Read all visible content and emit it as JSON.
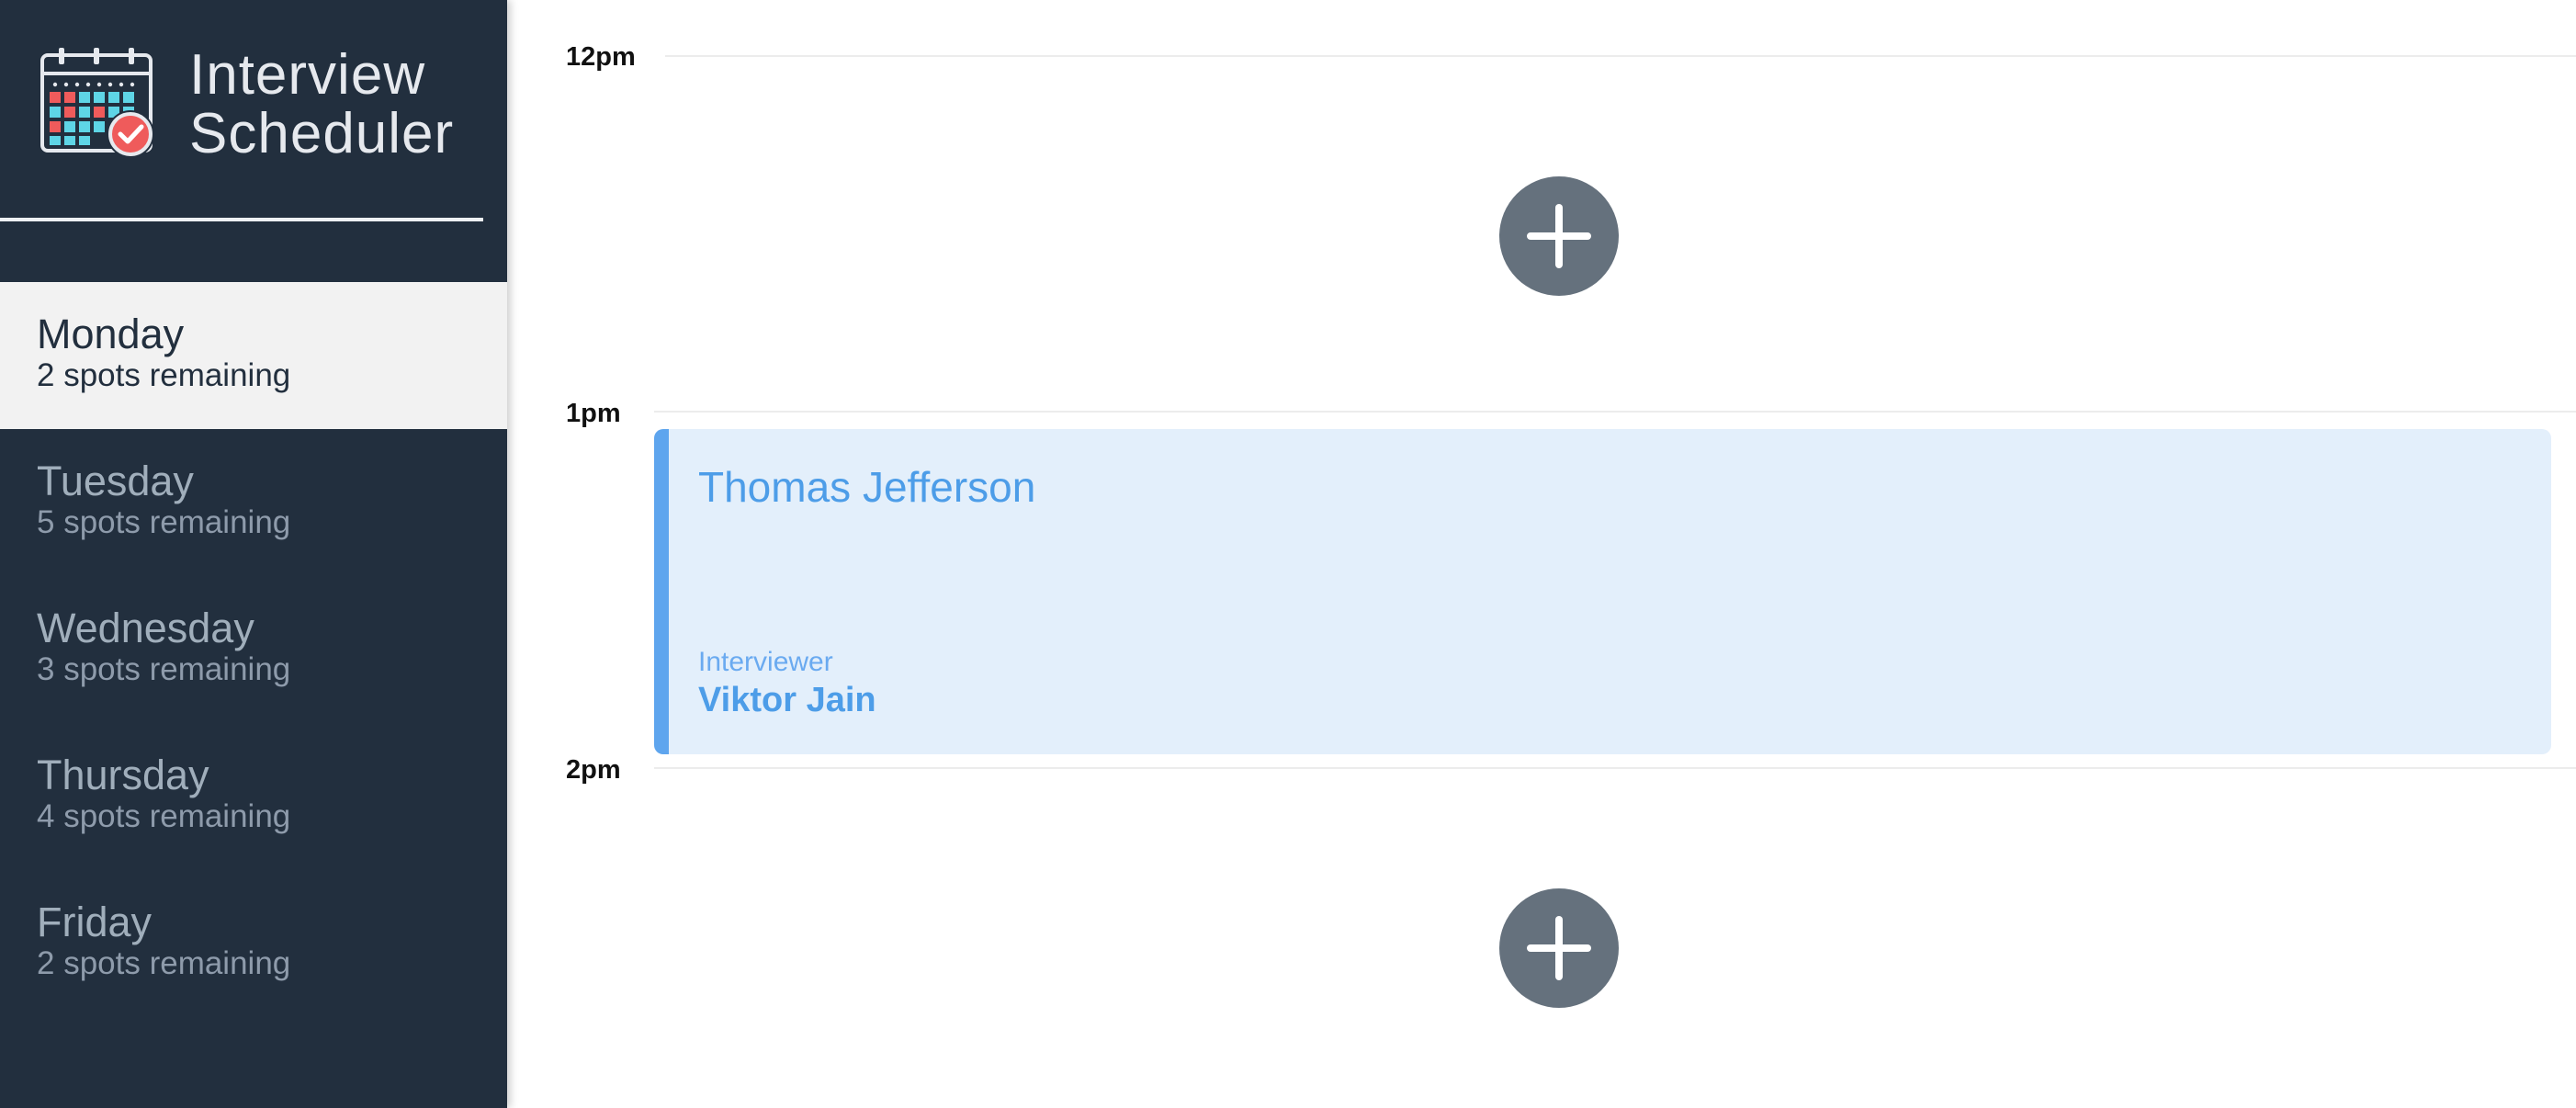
{
  "app": {
    "title_line1": "Interview",
    "title_line2": "Scheduler",
    "logo_icon": "calendar-check-icon"
  },
  "sidebar": {
    "days": [
      {
        "name": "Monday",
        "spots": "2 spots remaining",
        "selected": true
      },
      {
        "name": "Tuesday",
        "spots": "5 spots remaining",
        "selected": false
      },
      {
        "name": "Wednesday",
        "spots": "3 spots remaining",
        "selected": false
      },
      {
        "name": "Thursday",
        "spots": "4 spots remaining",
        "selected": false
      },
      {
        "name": "Friday",
        "spots": "2 spots remaining",
        "selected": false
      }
    ]
  },
  "schedule": {
    "times": [
      "12pm",
      "1pm",
      "2pm"
    ],
    "add_icon": "plus-icon",
    "appointment": {
      "student": "Thomas Jefferson",
      "interviewer_label": "Interviewer",
      "interviewer": "Viktor Jain"
    }
  },
  "colors": {
    "sidebar_bg": "#222f3e",
    "selected_bg": "#f2f2f2",
    "accent": "#5ea5ee",
    "card_bg": "#e3effb",
    "add_button": "#65717d"
  }
}
